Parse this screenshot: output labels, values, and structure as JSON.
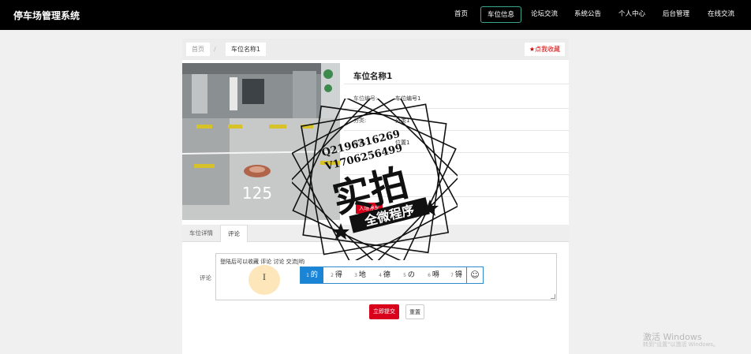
{
  "app": {
    "title": "停车场管理系统"
  },
  "nav": {
    "items": [
      "首页",
      "车位信息",
      "论坛交流",
      "系统公告",
      "个人中心",
      "后台管理",
      "在线交流"
    ],
    "active_index": 1
  },
  "breadcrumb": {
    "home": "首页",
    "separator": "/",
    "current": "车位名称1"
  },
  "favorite_button": {
    "icon": "star-icon",
    "label": "点我收藏"
  },
  "detail": {
    "name": "车位名称1",
    "rows": [
      {
        "key": "车位编号:",
        "value": "车位编号1"
      },
      {
        "key": "分类:",
        "value": "分类1"
      },
      {
        "key": "位置:",
        "value": "位置1"
      }
    ],
    "park_button": "入场停车",
    "photo_text": "125"
  },
  "tabs": {
    "items": [
      "车位详情",
      "评论"
    ],
    "active_index": 1
  },
  "comment": {
    "label": "评论",
    "value": "登陆后可以收藏 评论 讨论 交流|哟",
    "ime": {
      "candidates": [
        {
          "num": "1",
          "ch": "的"
        },
        {
          "num": "2",
          "ch": "得"
        },
        {
          "num": "3",
          "ch": "地"
        },
        {
          "num": "4",
          "ch": "德"
        },
        {
          "num": "5",
          "ch": "の"
        },
        {
          "num": "6",
          "ch": "嘚"
        },
        {
          "num": "7",
          "ch": "锝"
        }
      ],
      "selected_index": 0,
      "emoji": "☺"
    }
  },
  "actions": {
    "submit": "立即提交",
    "reset": "重置"
  },
  "watermark": {
    "line1": "Q2196316269",
    "line2": "V1706256499",
    "big": "实拍",
    "banner": "全微程序"
  },
  "windows_watermark": {
    "line1": "激活 Windows",
    "line2": "转到\"设置\"以激活 Windows。"
  },
  "colors": {
    "accent": "#38a78e",
    "danger": "#d9001b",
    "ime_blue": "#1a84d6"
  }
}
